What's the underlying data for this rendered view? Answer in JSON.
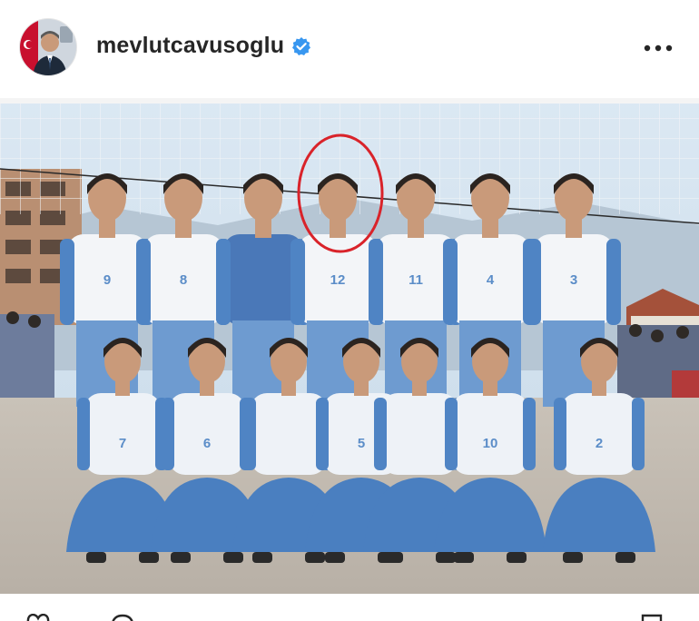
{
  "post": {
    "username": "mevlutcavusoglu",
    "verified": true,
    "icons": {
      "more": "more-horizontal-icon",
      "verified": "verified-badge-icon",
      "like": "heart-icon",
      "comment": "comment-icon",
      "save": "bookmark-icon"
    },
    "colors": {
      "verified": "#3897f0",
      "text": "#262626",
      "circle": "#d9232a"
    }
  },
  "photo": {
    "jerseys": {
      "back_row": [
        "9",
        "8",
        "",
        "12",
        "11",
        "4",
        "3"
      ],
      "front_row": [
        "7",
        "6",
        "",
        "5",
        "",
        "10",
        "2"
      ]
    }
  }
}
